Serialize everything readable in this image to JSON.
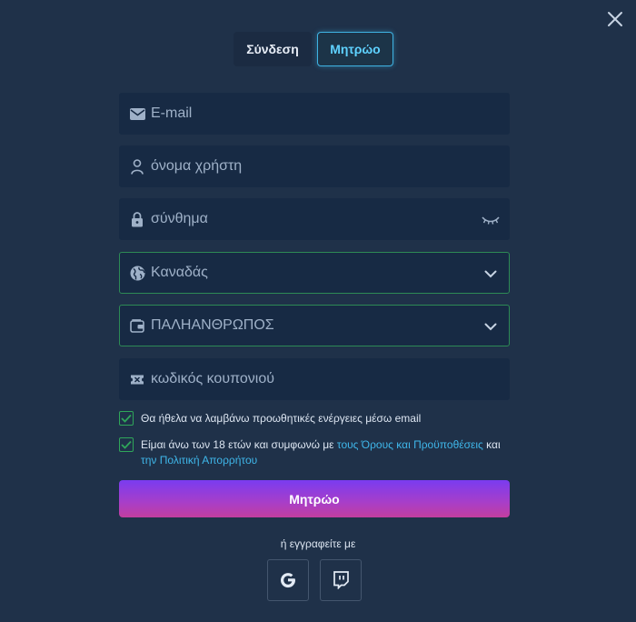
{
  "tabs": {
    "login": "Σύνδεση",
    "register": "Μητρώο"
  },
  "fields": {
    "email": {
      "placeholder": "E-mail",
      "icon": "envelope-icon"
    },
    "username": {
      "placeholder": "όνομα χρήστη",
      "icon": "user-icon"
    },
    "password": {
      "placeholder": "σύνθημα",
      "icon": "lock-icon",
      "toggle_icon": "eye-closed-icon"
    },
    "country": {
      "value": "Καναδάς",
      "icon": "globe-icon"
    },
    "currency": {
      "value": "ΠΑΛΗΑΝΘΡΩΠΟΣ",
      "icon": "wallet-icon"
    },
    "coupon": {
      "placeholder": "κωδικός κουπονιού",
      "icon": "ticket-icon"
    }
  },
  "checkboxes": {
    "promo": {
      "label": "Θα ήθελα να λαμβάνω προωθητικές ενέργειες μέσω email",
      "checked": true
    },
    "terms": {
      "text_before": "Είμαι άνω των 18 ετών και συμφωνώ με ",
      "terms_link": "τους Όρους και Προϋποθέσεις",
      "text_mid": " και ",
      "privacy_link": "την Πολιτική Απορρήτου",
      "checked": true
    }
  },
  "submit_label": "Μητρώο",
  "or_label": "ή εγγραφείτε με",
  "social": [
    {
      "icon": "google-icon"
    },
    {
      "icon": "twitch-icon"
    }
  ],
  "colors": {
    "accent": "#3fb2e2",
    "check": "#2fa65a",
    "gradient_start": "#7a3cf0",
    "gradient_end": "#c23e9e"
  }
}
